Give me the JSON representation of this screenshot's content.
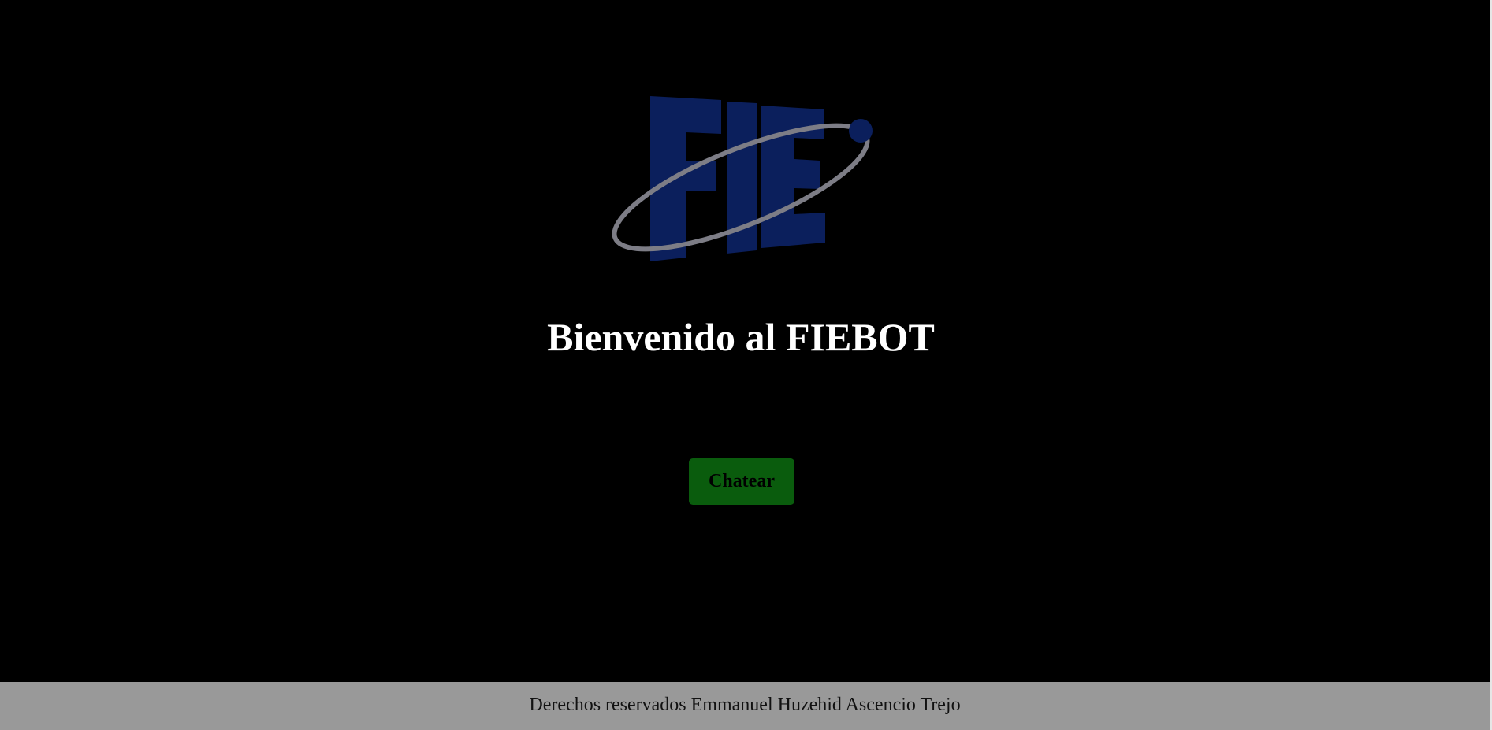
{
  "logo": {
    "text": "FIE",
    "letter_color": "#0b1f5c",
    "orbit_color": "#7d7d86",
    "dot_color": "#0b1f5c"
  },
  "main": {
    "title": "Bienvenido al FIEBOT",
    "chat_button_label": "Chatear",
    "chat_button_color": "#0a5c0d"
  },
  "footer": {
    "text": "Derechos reservados Emmanuel Huzehid Ascencio Trejo",
    "background": "#999999"
  }
}
